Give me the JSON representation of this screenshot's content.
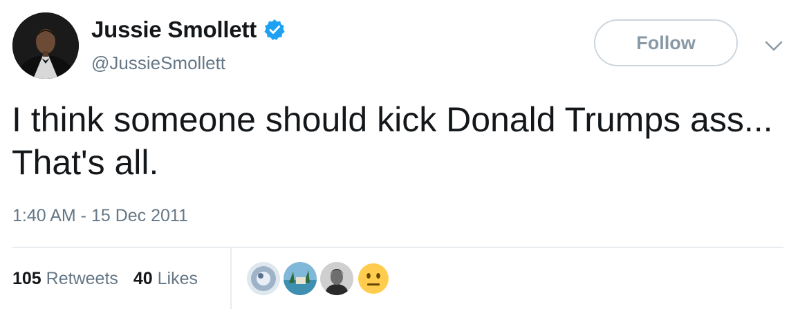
{
  "user": {
    "display_name": "Jussie Smollett",
    "handle": "@JussieSmollett",
    "verified": true,
    "avatar_icon": "profile-photo"
  },
  "follow_button": {
    "label": "Follow"
  },
  "menu": {
    "icon": "chevron-down-icon"
  },
  "tweet": {
    "text": "I think someone should kick Donald Trumps ass... That's all.",
    "timestamp": "1:40 AM - 15 Dec 2011"
  },
  "stats": {
    "retweets_count": "105",
    "retweets_label": "Retweets",
    "likes_count": "40",
    "likes_label": "Likes"
  },
  "likers": [
    {
      "icon": "liker-avatar-1"
    },
    {
      "icon": "liker-avatar-2"
    },
    {
      "icon": "liker-avatar-3"
    },
    {
      "icon": "neutral-face-emoji-icon"
    }
  ],
  "colors": {
    "verified_blue": "#1da1f2",
    "text_primary": "#14171a",
    "text_secondary": "#657786",
    "border": "#ccd6dd",
    "follow_text": "#8899a6"
  }
}
